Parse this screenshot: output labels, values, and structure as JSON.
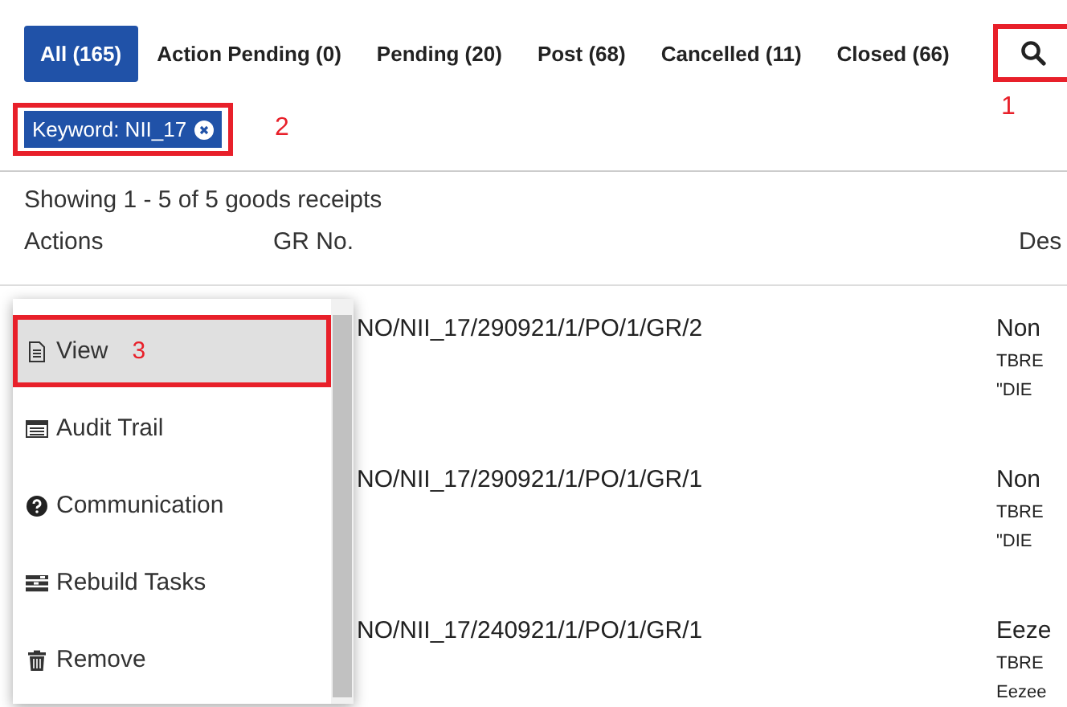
{
  "tabs": [
    {
      "label": "All (165)",
      "selected": true
    },
    {
      "label": "Action Pending (0)",
      "selected": false
    },
    {
      "label": "Pending (20)",
      "selected": false
    },
    {
      "label": "Post (68)",
      "selected": false
    },
    {
      "label": "Cancelled (11)",
      "selected": false
    },
    {
      "label": "Closed (66)",
      "selected": false
    }
  ],
  "search_button": {
    "callout": "1"
  },
  "filter_chip": {
    "label": "Keyword: NII_17",
    "callout": "2"
  },
  "summary": "Showing 1 - 5 of 5 goods receipts",
  "table": {
    "columns": [
      "Actions",
      "GR No.",
      "Des"
    ],
    "rows": [
      {
        "gr_no": "NO/NII_17/290921/1/PO/1/GR/2",
        "description": [
          "Non",
          "TBRE",
          "\"DIE"
        ]
      },
      {
        "gr_no": "NO/NII_17/290921/1/PO/1/GR/1",
        "description": [
          "Non",
          "TBRE",
          "\"DIE"
        ]
      },
      {
        "gr_no": "NO/NII_17/240921/1/PO/1/GR/1",
        "description": [
          "Eeze",
          "TBRE",
          "Eezee"
        ]
      }
    ]
  },
  "action_menu": {
    "items": [
      {
        "kind": "document",
        "label": "View",
        "selected": true,
        "callout": "3"
      },
      {
        "kind": "list",
        "label": "Audit Trail",
        "selected": false
      },
      {
        "kind": "question",
        "label": "Communication",
        "selected": false
      },
      {
        "kind": "tasks",
        "label": "Rebuild Tasks",
        "selected": false
      },
      {
        "kind": "trash",
        "label": "Remove",
        "selected": false
      }
    ]
  }
}
